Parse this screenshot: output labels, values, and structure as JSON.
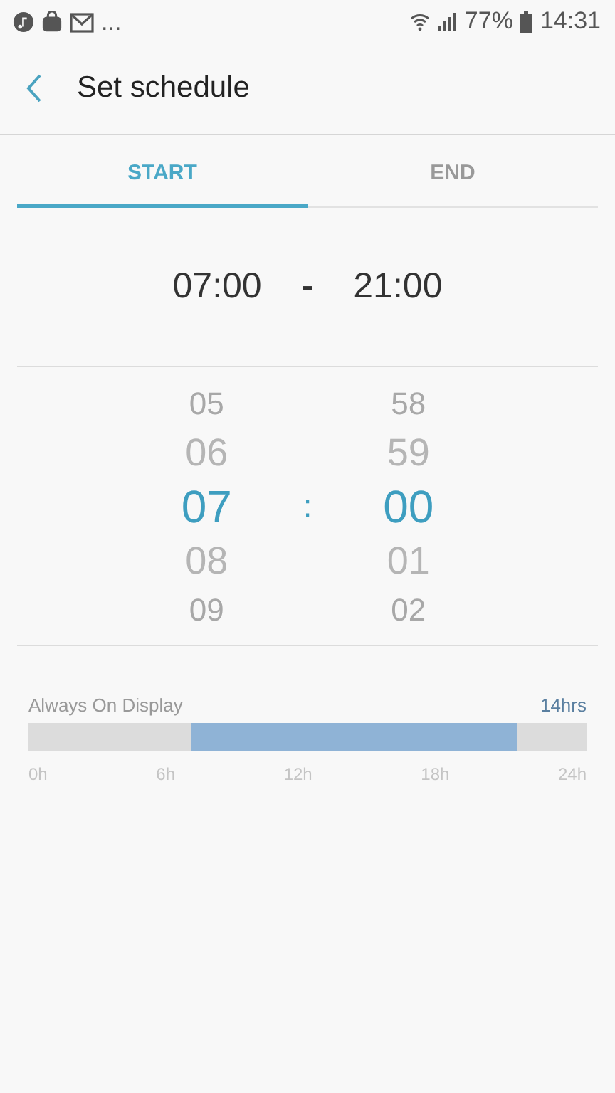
{
  "status_bar": {
    "overflow": "...",
    "battery": "77%",
    "time": "14:31"
  },
  "header": {
    "title": "Set schedule"
  },
  "tabs": [
    {
      "label": "START",
      "selected": true
    },
    {
      "label": "END",
      "selected": false
    }
  ],
  "summary": {
    "start": "07:00",
    "separator": "-",
    "end": "21:00"
  },
  "picker": {
    "hours": [
      {
        "value": "05",
        "selected": false
      },
      {
        "value": "06",
        "selected": false
      },
      {
        "value": "07",
        "selected": true
      },
      {
        "value": "08",
        "selected": false
      },
      {
        "value": "09",
        "selected": false
      }
    ],
    "separator": ":",
    "minutes": [
      {
        "value": "58",
        "selected": false
      },
      {
        "value": "59",
        "selected": false
      },
      {
        "value": "00",
        "selected": true
      },
      {
        "value": "01",
        "selected": false
      },
      {
        "value": "02",
        "selected": false
      }
    ]
  },
  "timeline": {
    "label": "Always On Display",
    "duration": "14hrs",
    "ticks": [
      "0h",
      "6h",
      "12h",
      "18h",
      "24h"
    ]
  }
}
